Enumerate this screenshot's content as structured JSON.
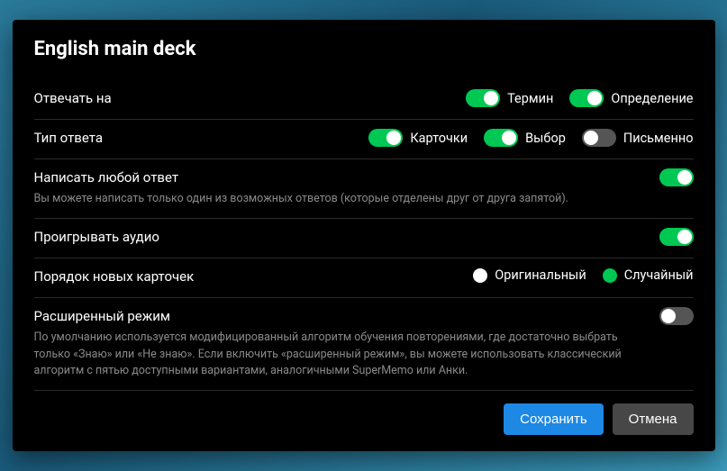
{
  "title": "English main deck",
  "rows": {
    "answer_on": {
      "label": "Отвечать на",
      "options": [
        {
          "label": "Термин",
          "on": true
        },
        {
          "label": "Определение",
          "on": true
        }
      ]
    },
    "answer_type": {
      "label": "Тип ответа",
      "options": [
        {
          "label": "Карточки",
          "on": true
        },
        {
          "label": "Выбор",
          "on": true
        },
        {
          "label": "Письменно",
          "on": false
        }
      ]
    },
    "any_answer": {
      "label": "Написать любой ответ",
      "sub": "Вы можете написать только один из возможных ответов (которые отделены друг от друга запятой).",
      "on": true
    },
    "play_audio": {
      "label": "Проигрывать аудио",
      "on": true
    },
    "card_order": {
      "label": "Порядок новых карточек",
      "options": [
        {
          "label": "Оригинальный",
          "selected": false
        },
        {
          "label": "Случайный",
          "selected": true
        }
      ]
    },
    "advanced": {
      "label": "Расширенный режим",
      "sub": "По умолчанию используется модифицированный алгоритм обучения повторениями, где достаточно выбрать только «Знаю» или «Не знаю». Если включить «расширенный режим», вы можете использовать классический алгоритм с пятью доступными вариантами, аналогичными SuperMemo или Анки.",
      "on": false
    }
  },
  "buttons": {
    "save": "Сохранить",
    "cancel": "Отмена"
  }
}
